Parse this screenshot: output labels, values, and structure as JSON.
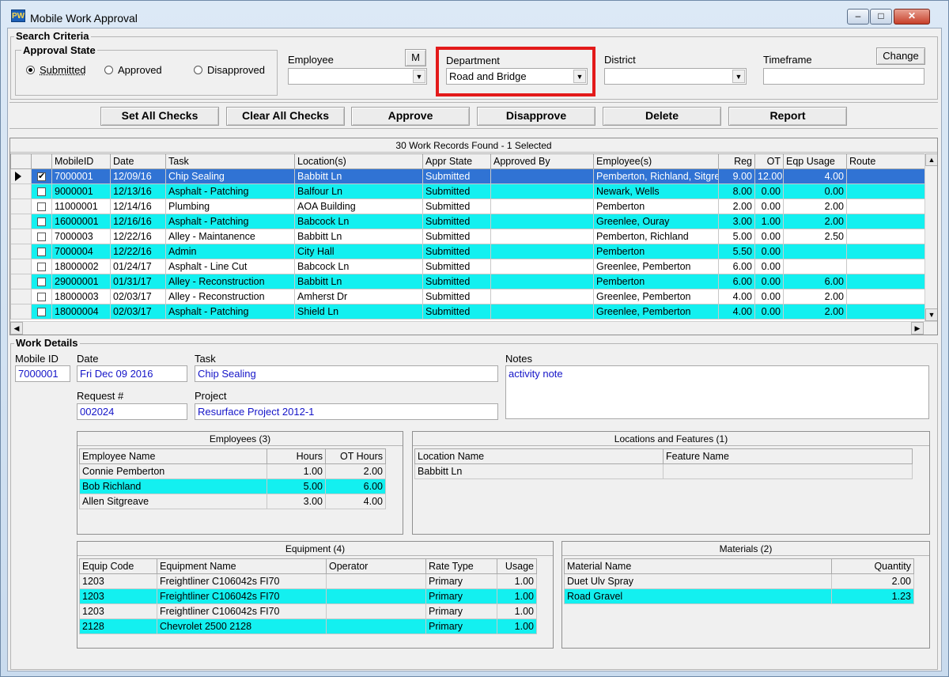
{
  "window": {
    "title": "Mobile Work Approval",
    "app_icon_text": "PW",
    "controls": {
      "minimize": "–",
      "maximize": "□",
      "close": "✕"
    }
  },
  "search": {
    "title": "Search Criteria",
    "approval_state": {
      "title": "Approval State",
      "options": [
        {
          "label": "Submitted",
          "selected": true
        },
        {
          "label": "Approved",
          "selected": false
        },
        {
          "label": "Disapproved",
          "selected": false
        }
      ]
    },
    "employee": {
      "label": "Employee",
      "value": "",
      "m_button": "M"
    },
    "department": {
      "label": "Department",
      "value": "Road and Bridge"
    },
    "district": {
      "label": "District",
      "value": ""
    },
    "timeframe": {
      "label": "Timeframe",
      "value": "",
      "change_button": "Change"
    }
  },
  "actions": {
    "set_all": "Set All Checks",
    "clear_all": "Clear All Checks",
    "approve": "Approve",
    "disapprove": "Disapprove",
    "delete": "Delete",
    "report": "Report"
  },
  "records": {
    "caption": "30 Work Records Found - 1 Selected",
    "columns": [
      "MobileID",
      "Date",
      "Task",
      "Location(s)",
      "Appr State",
      "Approved By",
      "Employee(s)",
      "Reg",
      "OT",
      "Eqp Usage",
      "Route"
    ],
    "rows": [
      {
        "style": "sel",
        "checked": true,
        "current": true,
        "cells": [
          "7000001",
          "12/09/16",
          "Chip Sealing",
          "Babbitt Ln",
          "Submitted",
          "",
          "Pemberton, Richland, Sitgre",
          "9.00",
          "12.00",
          "4.00",
          ""
        ]
      },
      {
        "style": "cyan",
        "checked": false,
        "current": false,
        "cells": [
          "9000001",
          "12/13/16",
          "Asphalt - Patching",
          "Balfour Ln",
          "Submitted",
          "",
          "Newark, Wells",
          "8.00",
          "0.00",
          "0.00",
          ""
        ]
      },
      {
        "style": "white",
        "checked": false,
        "current": false,
        "cells": [
          "11000001",
          "12/14/16",
          "Plumbing",
          "AOA Building",
          "Submitted",
          "",
          "Pemberton",
          "2.00",
          "0.00",
          "2.00",
          ""
        ]
      },
      {
        "style": "cyan",
        "checked": false,
        "current": false,
        "cells": [
          "16000001",
          "12/16/16",
          "Asphalt - Patching",
          "Babcock Ln",
          "Submitted",
          "",
          "Greenlee, Ouray",
          "3.00",
          "1.00",
          "2.00",
          ""
        ]
      },
      {
        "style": "white",
        "checked": false,
        "current": false,
        "cells": [
          "7000003",
          "12/22/16",
          "Alley - Maintanence",
          "Babbitt Ln",
          "Submitted",
          "",
          "Pemberton, Richland",
          "5.00",
          "0.00",
          "2.50",
          ""
        ]
      },
      {
        "style": "cyan",
        "checked": false,
        "current": false,
        "cells": [
          "7000004",
          "12/22/16",
          "Admin",
          "City Hall",
          "Submitted",
          "",
          "Pemberton",
          "5.50",
          "0.00",
          "",
          ""
        ]
      },
      {
        "style": "white",
        "checked": false,
        "current": false,
        "cells": [
          "18000002",
          "01/24/17",
          "Asphalt - Line Cut",
          "Babcock Ln",
          "Submitted",
          "",
          "Greenlee, Pemberton",
          "6.00",
          "0.00",
          "",
          ""
        ]
      },
      {
        "style": "cyan",
        "checked": false,
        "current": false,
        "cells": [
          "29000001",
          "01/31/17",
          "Alley - Reconstruction",
          "Babbitt Ln",
          "Submitted",
          "",
          "Pemberton",
          "6.00",
          "0.00",
          "6.00",
          ""
        ]
      },
      {
        "style": "white",
        "checked": false,
        "current": false,
        "cells": [
          "18000003",
          "02/03/17",
          "Alley - Reconstruction",
          "Amherst Dr",
          "Submitted",
          "",
          "Greenlee, Pemberton",
          "4.00",
          "0.00",
          "2.00",
          ""
        ]
      },
      {
        "style": "cyan",
        "checked": false,
        "current": false,
        "cells": [
          "18000004",
          "02/03/17",
          "Asphalt - Patching",
          "Shield Ln",
          "Submitted",
          "",
          "Greenlee, Pemberton",
          "4.00",
          "0.00",
          "2.00",
          ""
        ]
      }
    ]
  },
  "details": {
    "title": "Work Details",
    "mobile_id": {
      "label": "Mobile ID",
      "value": "7000001"
    },
    "date": {
      "label": "Date",
      "value": "Fri Dec 09 2016"
    },
    "task": {
      "label": "Task",
      "value": "Chip Sealing"
    },
    "notes": {
      "label": "Notes",
      "value": "activity note"
    },
    "request": {
      "label": "Request #",
      "value": "002024"
    },
    "project": {
      "label": "Project",
      "value": "Resurface Project 2012-1"
    }
  },
  "employees": {
    "caption": "Employees (3)",
    "columns": [
      "Employee Name",
      "Hours",
      "OT Hours"
    ],
    "rows": [
      {
        "style": "white",
        "cells": [
          "Connie Pemberton",
          "1.00",
          "2.00"
        ]
      },
      {
        "style": "cyan",
        "cells": [
          "Bob Richland",
          "5.00",
          "6.00"
        ]
      },
      {
        "style": "white",
        "cells": [
          "Allen Sitgreave",
          "3.00",
          "4.00"
        ]
      }
    ]
  },
  "locations": {
    "caption": "Locations and Features (1)",
    "columns": [
      "Location Name",
      "Feature Name"
    ],
    "rows": [
      {
        "style": "white",
        "cells": [
          "Babbitt Ln",
          ""
        ]
      }
    ]
  },
  "equipment": {
    "caption": "Equipment (4)",
    "columns": [
      "Equip Code",
      "Equipment Name",
      "Operator",
      "Rate Type",
      "Usage"
    ],
    "rows": [
      {
        "style": "white",
        "cells": [
          "1203",
          "Freightliner C106042s FI70",
          "",
          "Primary",
          "1.00"
        ]
      },
      {
        "style": "cyan",
        "cells": [
          "1203",
          "Freightliner C106042s FI70",
          "",
          "Primary",
          "1.00"
        ]
      },
      {
        "style": "white",
        "cells": [
          "1203",
          "Freightliner C106042s FI70",
          "",
          "Primary",
          "1.00"
        ]
      },
      {
        "style": "cyan",
        "cells": [
          "2128",
          "Chevrolet 2500 2128",
          "",
          "Primary",
          "1.00"
        ]
      }
    ]
  },
  "materials": {
    "caption": "Materials (2)",
    "columns": [
      "Material Name",
      "Quantity"
    ],
    "rows": [
      {
        "style": "white",
        "cells": [
          "Duet Ulv Spray",
          "2.00"
        ]
      },
      {
        "style": "cyan",
        "cells": [
          "Road Gravel",
          "1.23"
        ]
      }
    ]
  }
}
